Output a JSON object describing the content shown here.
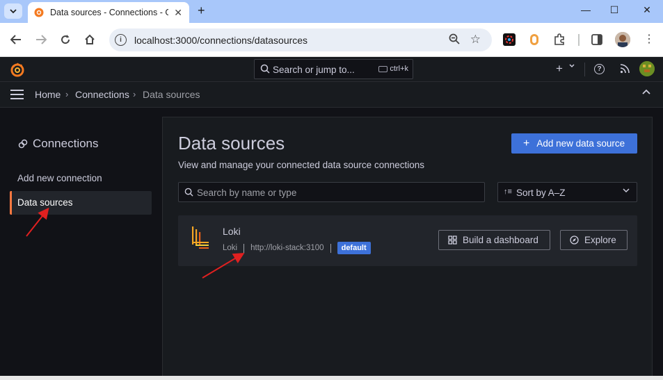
{
  "browser": {
    "tab_title": "Data sources - Connections - G",
    "url": "localhost:3000/connections/datasources",
    "new_tab_symbol": "+",
    "window_controls": [
      "—",
      "☐",
      "✕"
    ]
  },
  "grafana": {
    "search": {
      "placeholder": "Search or jump to...",
      "shortcut": "ctrl+k"
    },
    "breadcrumbs": [
      "Home",
      "Connections",
      "Data sources"
    ],
    "sidebar": {
      "title": "Connections",
      "items": [
        {
          "label": "Add new connection",
          "active": false
        },
        {
          "label": "Data sources",
          "active": true
        }
      ]
    },
    "page": {
      "title": "Data sources",
      "subtitle": "View and manage your connected data source connections",
      "add_button": "Add new data source",
      "search_placeholder": "Search by name or type",
      "sort_label": "Sort by A–Z"
    },
    "datasources": [
      {
        "name": "Loki",
        "type": "Loki",
        "url": "http://loki-stack:3100",
        "badge": "default",
        "build_button": "Build a dashboard",
        "explore_button": "Explore"
      }
    ]
  },
  "colors": {
    "accent": "#3d71d9",
    "active_marker": "#ff7941",
    "annotation_arrow": "#e02020"
  }
}
